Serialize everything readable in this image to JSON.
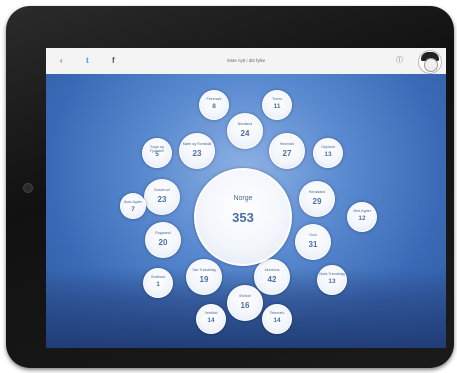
{
  "topbar": {
    "back_icon": "back-arrow-icon",
    "twitter_icon": "twitter-icon",
    "facebook_icon": "facebook-icon",
    "title": "Siste nytt i ditt fylke",
    "info_icon": "info-icon"
  },
  "center": {
    "label": "Norge",
    "count": "353"
  },
  "regions": [
    {
      "label": "Finnmark",
      "count": "8"
    },
    {
      "label": "Nordland",
      "count": "24"
    },
    {
      "label": "Troms",
      "count": "11"
    },
    {
      "label": "Sogn og Fjordane",
      "count": "5"
    },
    {
      "label": "Møre og Romsdal",
      "count": "23"
    },
    {
      "label": "Hedmark",
      "count": "27"
    },
    {
      "label": "Oppland",
      "count": "13"
    },
    {
      "label": "Buskerud",
      "count": "23"
    },
    {
      "label": "Hordaland",
      "count": "29"
    },
    {
      "label": "Aust-Agder",
      "count": "7"
    },
    {
      "label": "Vest-Agder",
      "count": "12"
    },
    {
      "label": "Rogaland",
      "count": "20"
    },
    {
      "label": "Oslo",
      "count": "31"
    },
    {
      "label": "Svalbard",
      "count": "1"
    },
    {
      "label": "Sør-Trøndelag",
      "count": "19"
    },
    {
      "label": "Akershus",
      "count": "42"
    },
    {
      "label": "Nord-Trøndelag",
      "count": "13"
    },
    {
      "label": "Østfold",
      "count": "16"
    },
    {
      "label": "Vestfold",
      "count": "14"
    },
    {
      "label": "Telemark",
      "count": "14"
    }
  ]
}
